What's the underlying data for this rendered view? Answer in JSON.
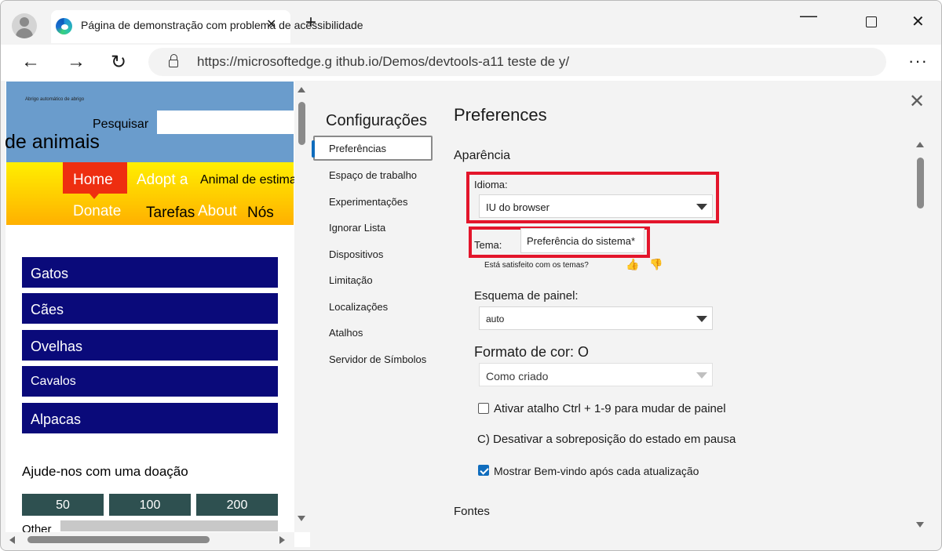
{
  "browser": {
    "tab_title": "Página de demonstração com problema de acessibilidade",
    "tab_close_glyph": "✕",
    "new_tab_glyph": "+",
    "url": "https://microsoftedge.g ithub.io/Demos/devtools-a11 teste de y/",
    "window_controls": {
      "minimize": "—",
      "close": "✕"
    },
    "nav_glyphs": {
      "back": "←",
      "forward": "→",
      "refresh": "↻",
      "more": "···"
    }
  },
  "demo_page": {
    "skip_link": "Abrigo automático de abrigo",
    "search_label": "Pesquisar",
    "search_value": "",
    "site_title": "de animais",
    "nav": {
      "home": "Home",
      "adopt": "Adopt a",
      "pet": "Animal de estimação",
      "donate": "Donate",
      "tarefas": "Tarefas",
      "about": "About",
      "nos": "Nós"
    },
    "animals": [
      "Gatos",
      "Cães",
      "Ovelhas",
      "Cavalos",
      "Alpacas"
    ],
    "donate_title": "Ajude-nos com uma doação",
    "amounts": [
      "50",
      "100",
      "200"
    ],
    "other_label": "Other"
  },
  "devtools": {
    "settings_heading": "Configurações",
    "settings_nav": [
      "Preferências",
      "Espaço de trabalho",
      "Experimentações",
      "Ignorar Lista",
      "Dispositivos",
      "Limitação",
      "Localizações",
      "Atalhos",
      "Servidor de Símbolos"
    ],
    "close_glyph": "✕",
    "title": "Preferences",
    "appearance_title": "Aparência",
    "language_label": "Idioma:",
    "language_value": "IU do browser",
    "theme_label": "Tema:",
    "theme_value": "Preferência do sistema*",
    "theme_feedback": "Está satisfeito com os temas?",
    "thumbs": {
      "up": "👍",
      "down": "👎"
    },
    "panel_layout_label": "Esquema de painel:",
    "panel_layout_value": "auto",
    "color_format_label": "Formato de cor: O",
    "color_format_value": "Como criado",
    "checkbox_ctrl": "Ativar atalho Ctrl + 1-9 para mudar de painel",
    "checkbox_ctrl_checked": false,
    "paused_text": "C) Desativar a sobreposição do estado em pausa",
    "checkbox_welcome": "Mostrar Bem-vindo após cada atualização",
    "checkbox_welcome_checked": true,
    "fonts_title": "Fontes"
  },
  "colors": {
    "highlight": "#e3152b",
    "accent": "#0f6cbd",
    "demo_header": "#6a9ccc",
    "animal_button": "#0a0a7a",
    "home_nav": "#ee2e10"
  }
}
